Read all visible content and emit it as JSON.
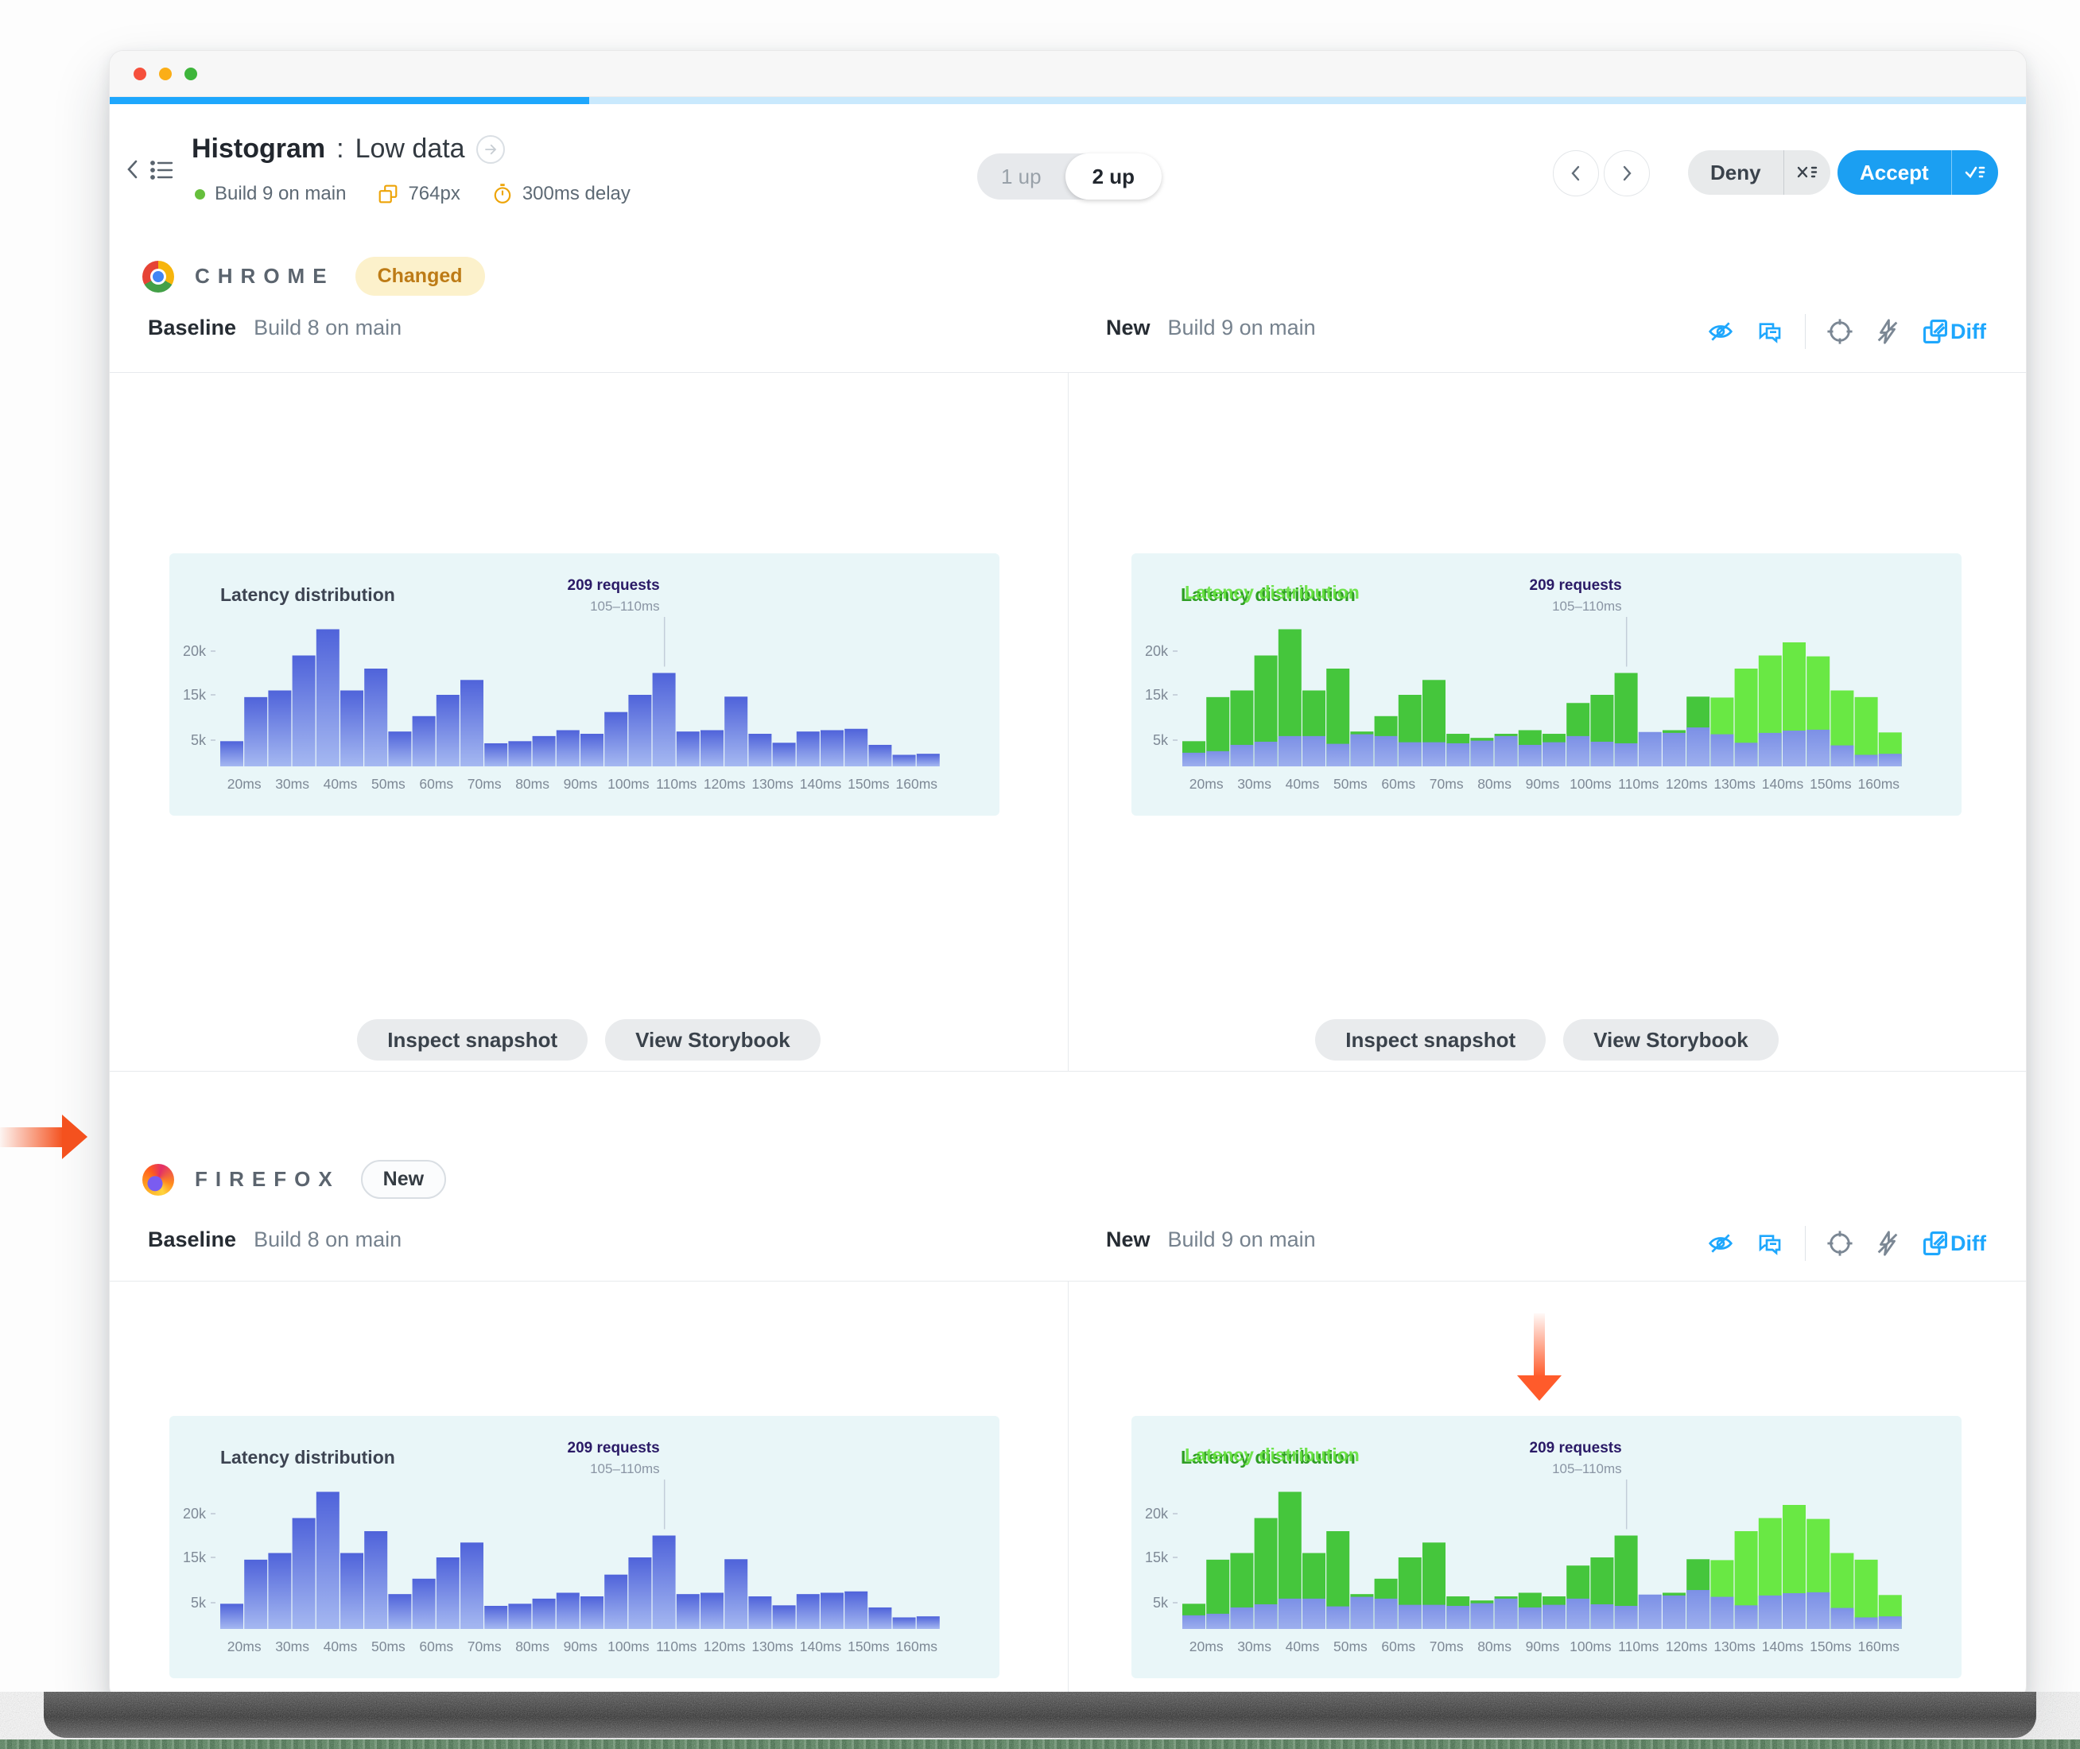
{
  "header": {
    "title": "Histogram",
    "separator": " : ",
    "story": "Low data",
    "build_status": "Build 9 on main",
    "viewport": "764px",
    "delay": "300ms delay",
    "toggle_1up": "1 up",
    "toggle_2up": "2 up",
    "deny": "Deny",
    "accept": "Accept"
  },
  "chrome_section": {
    "browser": "CHROME",
    "badge": "Changed"
  },
  "firefox_section": {
    "browser": "FIREFOX",
    "badge": "New"
  },
  "compare": {
    "baseline_label": "Baseline",
    "baseline_build": "Build 8 on main",
    "new_label": "New",
    "new_build": "Build 9 on main",
    "diff": "Diff"
  },
  "actions": {
    "inspect": "Inspect snapshot",
    "storybook": "View Storybook"
  },
  "chart_data": {
    "type": "bar",
    "title": "Latency distribution",
    "x_unit": "ms",
    "bin_width_ms": 5,
    "first_bin_start_ms": 15,
    "x_tick_labels": [
      "20ms",
      "30ms",
      "40ms",
      "50ms",
      "60ms",
      "70ms",
      "80ms",
      "90ms",
      "100ms",
      "110ms",
      "120ms",
      "130ms",
      "140ms",
      "150ms",
      "160ms"
    ],
    "y_tick_labels": [
      "20k",
      "15k",
      "5k"
    ],
    "annotation": {
      "label": "209 requests",
      "range": "105–110ms",
      "bin_index": 18
    },
    "series": [
      {
        "name": "baseline_build8_k",
        "values": [
          4.8,
          14.5,
          15.5,
          19.5,
          22.5,
          15.5,
          18,
          6.9,
          10.3,
          15,
          16.7,
          4.4,
          4.8,
          5.9,
          7.2,
          6.4,
          11.2,
          15,
          17.5,
          6.9,
          7.2,
          14.6,
          6.4,
          4.5,
          6.9,
          7.2,
          7.5,
          4.1,
          2.2,
          2.4
        ]
      },
      {
        "name": "new_build9_k",
        "values": [
          2.6,
          2.9,
          4.1,
          4.7,
          5.9,
          5.9,
          4.3,
          6.3,
          5.9,
          4.6,
          4.6,
          4.4,
          4.9,
          5.9,
          4.1,
          4.6,
          5.9,
          4.7,
          4.4,
          6.8,
          6.6,
          7.8,
          6.3,
          4.5,
          6.6,
          7.1,
          7.3,
          4.0,
          2.2,
          2.4
        ]
      },
      {
        "name": "diff_overlay_k",
        "values": [
          4.8,
          14.5,
          15.5,
          19.5,
          22.5,
          15.5,
          18,
          6.9,
          10.3,
          15,
          16.7,
          6.4,
          5.5,
          6.4,
          7.2,
          6.4,
          13.2,
          15,
          17.5,
          null,
          7.2,
          14.6,
          14.4,
          18,
          19.5,
          21,
          19.4,
          15.5,
          14.5,
          6.7
        ]
      }
    ],
    "colors": {
      "baseline_top": "#4f63da",
      "baseline_bottom": "#a5b8f1",
      "new_top": "#7c90e6",
      "new_bottom": "#9dafee",
      "diff_green": "#45c63c",
      "diff_green_bright": "#69e844",
      "background": "#e9f6f8",
      "annotation_text": "#2a1a66"
    },
    "diff_bright_from_index": 22,
    "ylim_k": [
      0,
      22.5
    ],
    "grid": false,
    "legend": "none"
  }
}
